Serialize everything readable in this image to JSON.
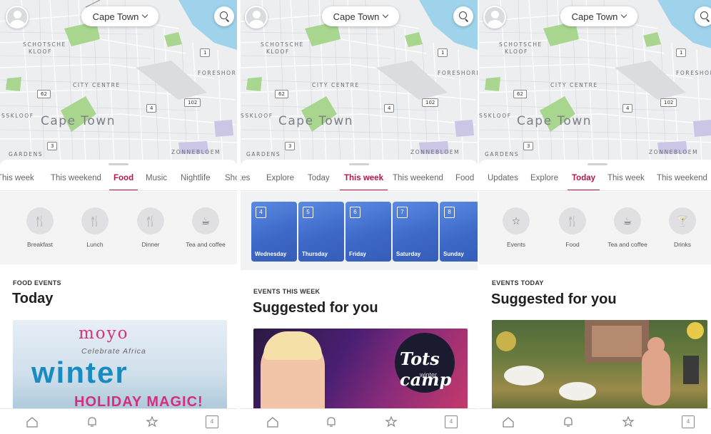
{
  "colors": {
    "accent": "#b3174f",
    "map_bg": "#eceef0",
    "park": "#a8d68f",
    "water": "#9fd3ec",
    "day_card": "#4a77d3"
  },
  "map": {
    "city": "Cape Town",
    "labels": {
      "schotsche": "SCHOTSCHE",
      "kloof": "KLOOF",
      "foreshore": "FORESHORE",
      "city_centre": "CITY CENTRE",
      "cape_town": "Cape Town",
      "sskloof": "SSKLOOF",
      "gardens": "GARDENS",
      "zonnebloem": "ZONNEBLOEM"
    },
    "routes": [
      "1",
      "62",
      "4",
      "102",
      "3"
    ]
  },
  "nav_icons": [
    "home-icon",
    "bell-icon",
    "star-icon",
    "calendar-icon"
  ],
  "nav_calendar_day": "4",
  "panels": [
    {
      "tabs": [
        "This week",
        "This weekend",
        "Food",
        "Music",
        "Nightlife",
        "Shop"
      ],
      "active_tab": "Food",
      "categories": [
        {
          "label": "Breakfast",
          "icon": "cutlery-icon"
        },
        {
          "label": "Lunch",
          "icon": "cutlery-icon"
        },
        {
          "label": "Dinner",
          "icon": "cutlery-icon"
        },
        {
          "label": "Tea and coffee",
          "icon": "cup-icon"
        }
      ],
      "section_eyebrow": "FOOD EVENTS",
      "section_title": "Today",
      "event": {
        "logo": "moyo",
        "tagline": "Celebrate Africa",
        "headline": "winter",
        "subheadline": "HOLIDAY MAGIC!"
      }
    },
    {
      "tabs": [
        "tes",
        "Explore",
        "Today",
        "This week",
        "This weekend",
        "Food"
      ],
      "active_tab": "This week",
      "days": [
        {
          "num": "4",
          "name": "Wednesday"
        },
        {
          "num": "5",
          "name": "Thursday"
        },
        {
          "num": "6",
          "name": "Friday"
        },
        {
          "num": "7",
          "name": "Saturday"
        },
        {
          "num": "8",
          "name": "Sunday"
        }
      ],
      "section_eyebrow": "EVENTS THIS WEEK",
      "section_title": "Suggested for you",
      "event": {
        "logo": "Tots camp",
        "sub": "winter"
      }
    },
    {
      "tabs": [
        "Updates",
        "Explore",
        "Today",
        "This week",
        "This weekend"
      ],
      "active_tab": "Today",
      "categories": [
        {
          "label": "Events",
          "icon": "star-box-icon"
        },
        {
          "label": "Food",
          "icon": "cutlery-icon"
        },
        {
          "label": "Tea and coffee",
          "icon": "cup-icon"
        },
        {
          "label": "Drinks",
          "icon": "cocktail-icon"
        }
      ],
      "section_eyebrow": "EVENTS TODAY",
      "section_title": "Suggested for you"
    }
  ]
}
